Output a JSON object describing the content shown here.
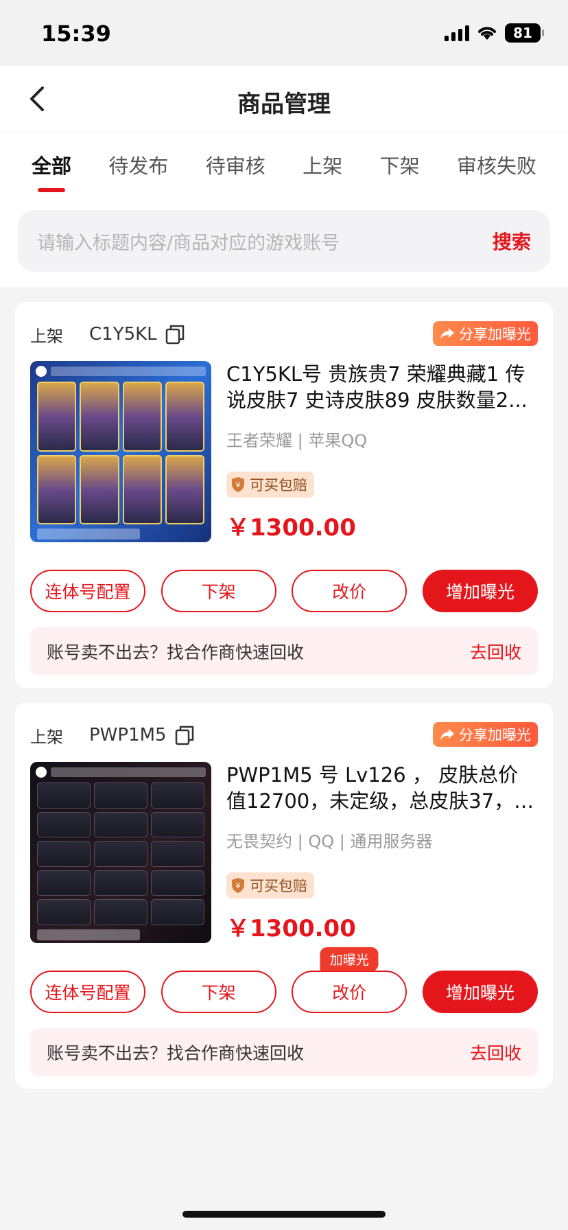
{
  "status_bar": {
    "time": "15:39",
    "battery": "81"
  },
  "header": {
    "title": "商品管理"
  },
  "tabs": [
    {
      "label": "全部",
      "active": true
    },
    {
      "label": "待发布"
    },
    {
      "label": "待审核"
    },
    {
      "label": "上架"
    },
    {
      "label": "下架"
    },
    {
      "label": "审核失败"
    }
  ],
  "search": {
    "placeholder": "请输入标题内容/商品对应的游戏账号",
    "button": "搜索"
  },
  "items": [
    {
      "status": "上架",
      "id": "C1Y5KL",
      "share_label": "分享加曝光",
      "title": "C1Y5KL号 贵族贵7 荣耀典藏1 传说皮肤7 史诗皮肤89 皮肤数量2...",
      "meta": "王者荣耀 | 苹果QQ",
      "guarantee": "可买包赔",
      "price": "￥1300.00",
      "actions": [
        "连体号配置",
        "下架",
        "改价",
        "增加曝光"
      ],
      "recycle_text": "账号卖不出去？找合作商快速回收",
      "recycle_link": "去回收"
    },
    {
      "status": "上架",
      "id": "PWP1M5",
      "share_label": "分享加曝光",
      "title": "PWP1M5 号 Lv126 ， 皮肤总价值12700，未定级，总皮肤37，刀...",
      "meta": "无畏契约 | QQ | 通用服务器",
      "guarantee": "可买包赔",
      "price": "￥1300.00",
      "actions": [
        "连体号配置",
        "下架",
        "改价",
        "增加曝光"
      ],
      "tip_badge": "加曝光",
      "recycle_text": "账号卖不出去？找合作商快速回收",
      "recycle_link": "去回收"
    }
  ],
  "colors": {
    "accent": "#e5161b",
    "background": "#f4f4f4"
  }
}
